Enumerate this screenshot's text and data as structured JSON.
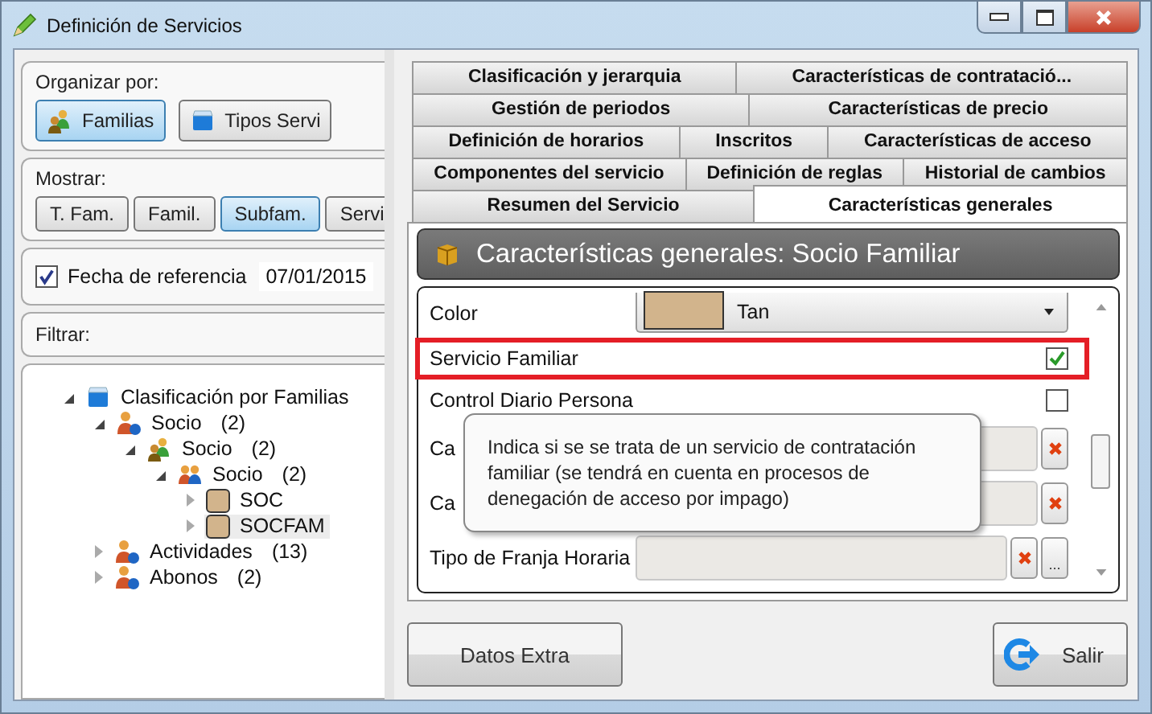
{
  "window": {
    "title": "Definición de Servicios"
  },
  "organize": {
    "label": "Organizar por:",
    "buttons": [
      {
        "label": "Familias",
        "selected": true,
        "kind": "families"
      },
      {
        "label": "Tipos Servi",
        "selected": false,
        "kind": "types"
      }
    ]
  },
  "show": {
    "label": "Mostrar:",
    "buttons": [
      {
        "label": "T. Fam.",
        "selected": false
      },
      {
        "label": "Famil.",
        "selected": false
      },
      {
        "label": "Subfam.",
        "selected": true
      },
      {
        "label": "Servi",
        "selected": false
      }
    ]
  },
  "reference_date": {
    "label": "Fecha de referencia",
    "checked": true,
    "value": "07/01/2015"
  },
  "filter": {
    "label": "Filtrar:"
  },
  "tree": [
    {
      "label": "Clasificación por Familias",
      "kind": "root",
      "expanded": true,
      "selected": false,
      "children": [
        {
          "label": "Socio",
          "count": "(2)",
          "kind": "family",
          "expanded": true,
          "selected": false,
          "children": [
            {
              "label": "Socio",
              "count": "(2)",
              "kind": "subfamily",
              "expanded": true,
              "selected": false,
              "children": [
                {
                  "label": "Socio",
                  "count": "(2)",
                  "kind": "group",
                  "expanded": true,
                  "selected": false,
                  "children": [
                    {
                      "label": "SOC",
                      "kind": "service",
                      "color": "#d2b48c",
                      "expanded": false,
                      "selected": false
                    },
                    {
                      "label": "SOCFAM",
                      "kind": "service",
                      "color": "#d2b48c",
                      "expanded": false,
                      "selected": true
                    }
                  ]
                }
              ]
            }
          ]
        },
        {
          "label": "Actividades",
          "count": "(13)",
          "kind": "family",
          "expanded": false,
          "selected": false
        },
        {
          "label": "Abonos",
          "count": "(2)",
          "kind": "family",
          "expanded": false,
          "selected": false
        }
      ]
    }
  ],
  "tab_rows": [
    [
      {
        "label": "Clasificación y jerarquia",
        "selected": false
      },
      {
        "label": "Características de contratació...",
        "selected": false
      }
    ],
    [
      {
        "label": "Gestión de periodos",
        "selected": false
      },
      {
        "label": "Características de precio",
        "selected": false
      }
    ],
    [
      {
        "label": "Definición de horarios",
        "selected": false
      },
      {
        "label": "Inscritos",
        "selected": false
      },
      {
        "label": "Características de acceso",
        "selected": false
      }
    ],
    [
      {
        "label": "Componentes del servicio",
        "selected": false
      },
      {
        "label": "Definición de reglas",
        "selected": false
      },
      {
        "label": "Historial de cambios",
        "selected": false
      }
    ],
    [
      {
        "label": "Resumen del Servicio",
        "selected": false
      },
      {
        "label": "Características generales",
        "selected": true
      }
    ]
  ],
  "header": {
    "title": "Características generales: Socio Familiar"
  },
  "fields": [
    {
      "kind": "dropdown",
      "label": "Color",
      "value": "Tan",
      "color": "#d2b48c",
      "highlighted": false
    },
    {
      "kind": "checkbox",
      "label": "Servicio Familiar",
      "checked": true,
      "highlighted": true
    },
    {
      "kind": "checkbox",
      "label": "Control Diario Persona",
      "checked": false,
      "highlighted": false
    },
    {
      "kind": "lookup",
      "label": "Ca",
      "highlighted": false
    },
    {
      "kind": "lookup",
      "label": "Ca",
      "highlighted": false
    },
    {
      "kind": "lookup_browse",
      "label": "Tipo de Franja Horaria",
      "browse_label": "...",
      "highlighted": false
    }
  ],
  "tooltip": {
    "text": "Indica si se se trata de un servicio de contratación familiar (se tendrá en cuenta en procesos de denegación de acceso por impago)"
  },
  "buttons": [
    {
      "label": "Datos Extra",
      "kind": "plain"
    },
    {
      "label": "Salir",
      "kind": "exit"
    }
  ]
}
